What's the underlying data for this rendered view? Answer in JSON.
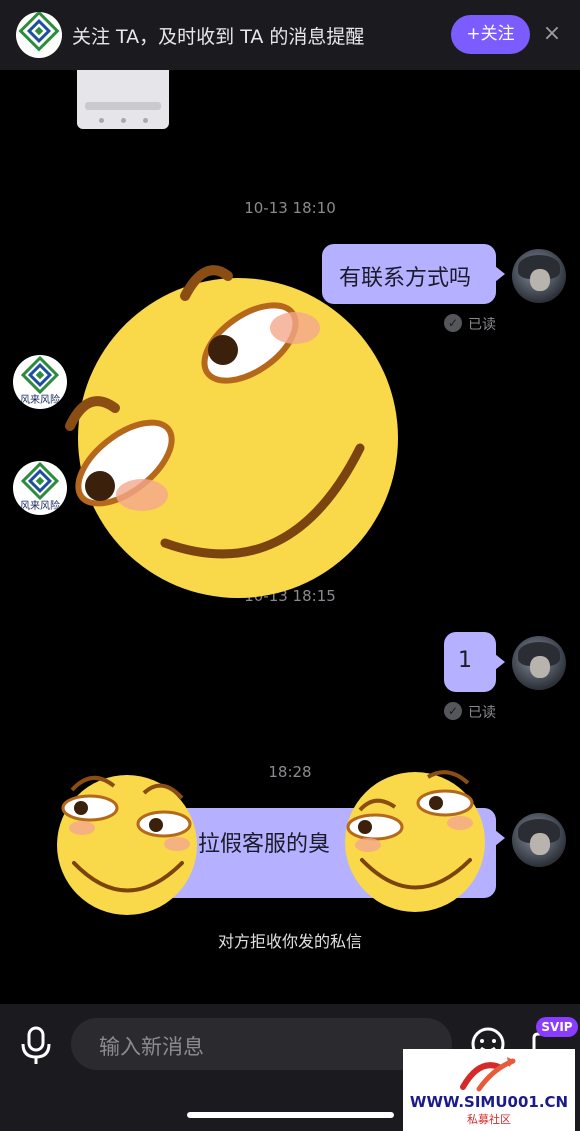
{
  "banner": {
    "text": "关注 TA，及时收到 TA 的消息提醒",
    "follow_label": "+关注",
    "close_label": "×"
  },
  "peer_logo_text": "风来风险",
  "messages": [
    {
      "time": "10-13  18:10",
      "text": "有联系方式吗",
      "status": "已读"
    },
    {
      "time": "10-13  18:15",
      "text": "1",
      "status": "已读"
    },
    {
      "time": "18:28",
      "text": "拉假客服的臭"
    }
  ],
  "system_note": "对方拒收你发的私信",
  "input": {
    "placeholder": "输入新消息"
  },
  "svip_badge": "SVIP",
  "watermark": {
    "url": "WWW.SIMU001.CN",
    "sub": "私募社区"
  },
  "colors": {
    "accent": "#7b5cff",
    "bubble": "#b5b0ff",
    "background": "#000000",
    "emoji": "#f9d84a"
  }
}
